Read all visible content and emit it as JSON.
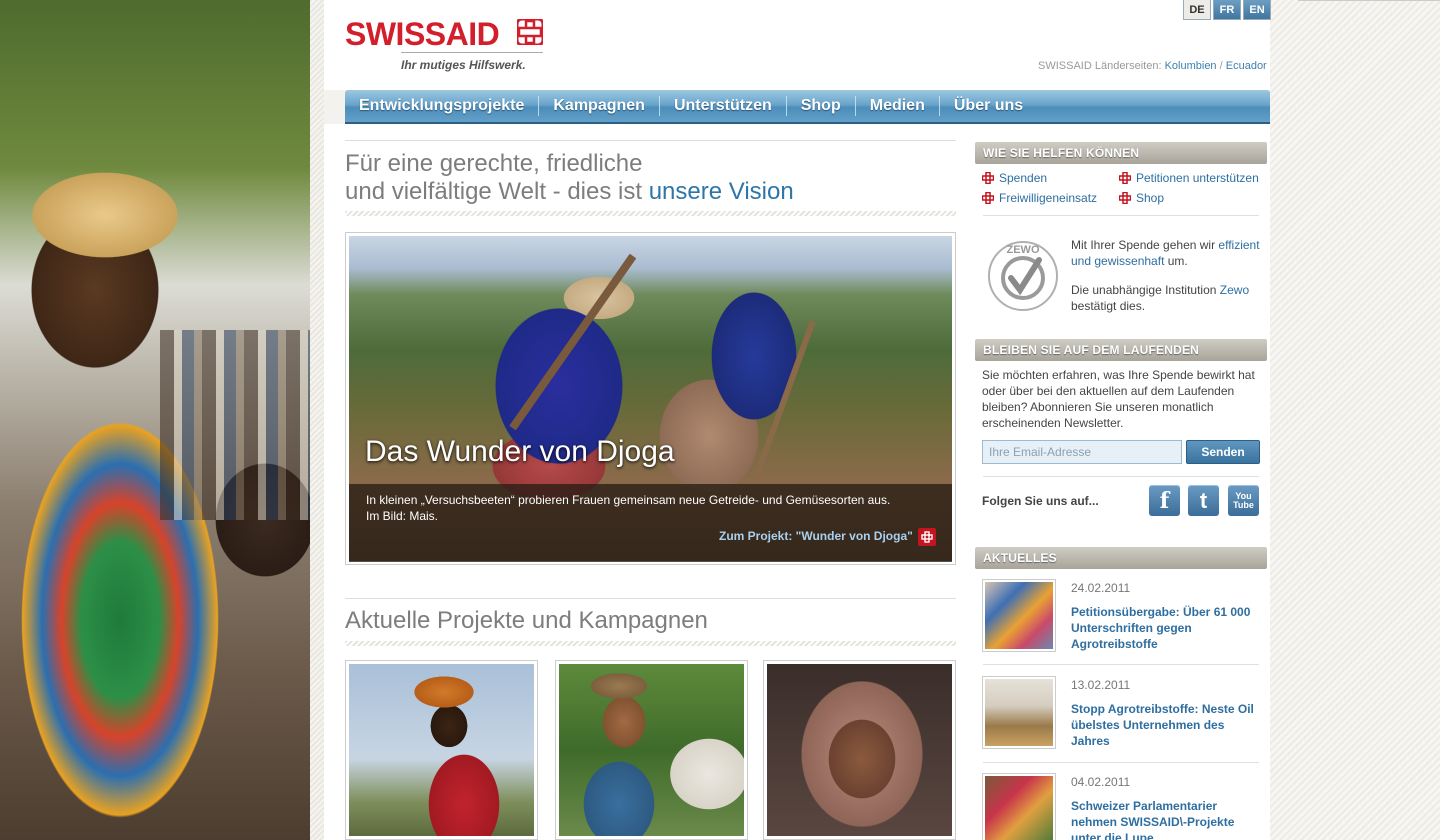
{
  "header": {
    "logo_text": "SWISSAID",
    "tagline": "Ihr mutiges Hilfswerk.",
    "languages": [
      {
        "code": "DE",
        "active": true
      },
      {
        "code": "FR",
        "active": false
      },
      {
        "code": "EN",
        "active": false
      }
    ],
    "country_label": "SWISSAID Länderseiten:",
    "country_links": [
      "Kolumbien",
      "Ecuador"
    ],
    "country_sep": "/"
  },
  "nav": {
    "items": [
      "Entwicklungsprojekte",
      "Kampagnen",
      "Unterstützen",
      "Shop",
      "Medien",
      "Über uns"
    ]
  },
  "main": {
    "vision_line1": "Für eine gerechte, friedliche",
    "vision_line2_prefix": "und vielfältige Welt - dies ist ",
    "vision_line2_highlight": "unsere Vision",
    "hero": {
      "title": "Das Wunder von Djoga",
      "text_line1": "In kleinen „Versuchsbeeten“ probieren Frauen gemeinsam neue Getreide- und Gemüsesorten aus.",
      "text_line2": "Im Bild: Mais.",
      "link": "Zum Projekt: \"Wunder von Djoga\""
    },
    "projects_title": "Aktuelle Projekte und Kampagnen"
  },
  "sidebar": {
    "help": {
      "heading": "WIE SIE HELFEN KÖNNEN",
      "links": [
        "Spenden",
        "Petitionen unterstützen",
        "Freiwilligeneinsatz",
        "Shop"
      ]
    },
    "zewo": {
      "text1_prefix": "Mit Ihrer Spende gehen wir",
      "text1_link": "effizient und gewissenhaft",
      "text1_suffix": " um.",
      "text2_prefix": "Die unabhängige Institution ",
      "text2_link": "Zewo",
      "text2_suffix": "bestätigt dies.",
      "logo_text": "ZEWO"
    },
    "newsletter": {
      "heading": "BLEIBEN SIE AUF DEM LAUFENDEN",
      "text": "Sie möchten erfahren, was Ihre Spende bewirkt hat oder über bei den aktuellen auf dem Laufenden bleiben? Abonnieren Sie unseren monatlich erscheinenden Newsletter.",
      "placeholder": "Ihre Email-Adresse",
      "button": "Senden"
    },
    "follow": {
      "label": "Folgen Sie uns auf...",
      "facebook": "f",
      "twitter": "t",
      "youtube": "You Tube"
    },
    "news": {
      "heading": "AKTUELLES",
      "items": [
        {
          "date": "24.02.2011",
          "title": "Petitionsübergabe: Über 61 000 Unterschriften gegen Agrotreibstoffe"
        },
        {
          "date": "13.02.2011",
          "title": "Stopp Agrotreibstoffe: Neste Oil übelstes Unternehmen des Jahres"
        },
        {
          "date": "04.02.2011",
          "title": "Schweizer Parlamentarier nehmen SWISSAID\\-Projekte unter die Lupe"
        }
      ]
    }
  },
  "colors": {
    "brand_red": "#d21f2b",
    "link_blue": "#2e6ea0",
    "nav_blue": "#4d8dbb"
  }
}
